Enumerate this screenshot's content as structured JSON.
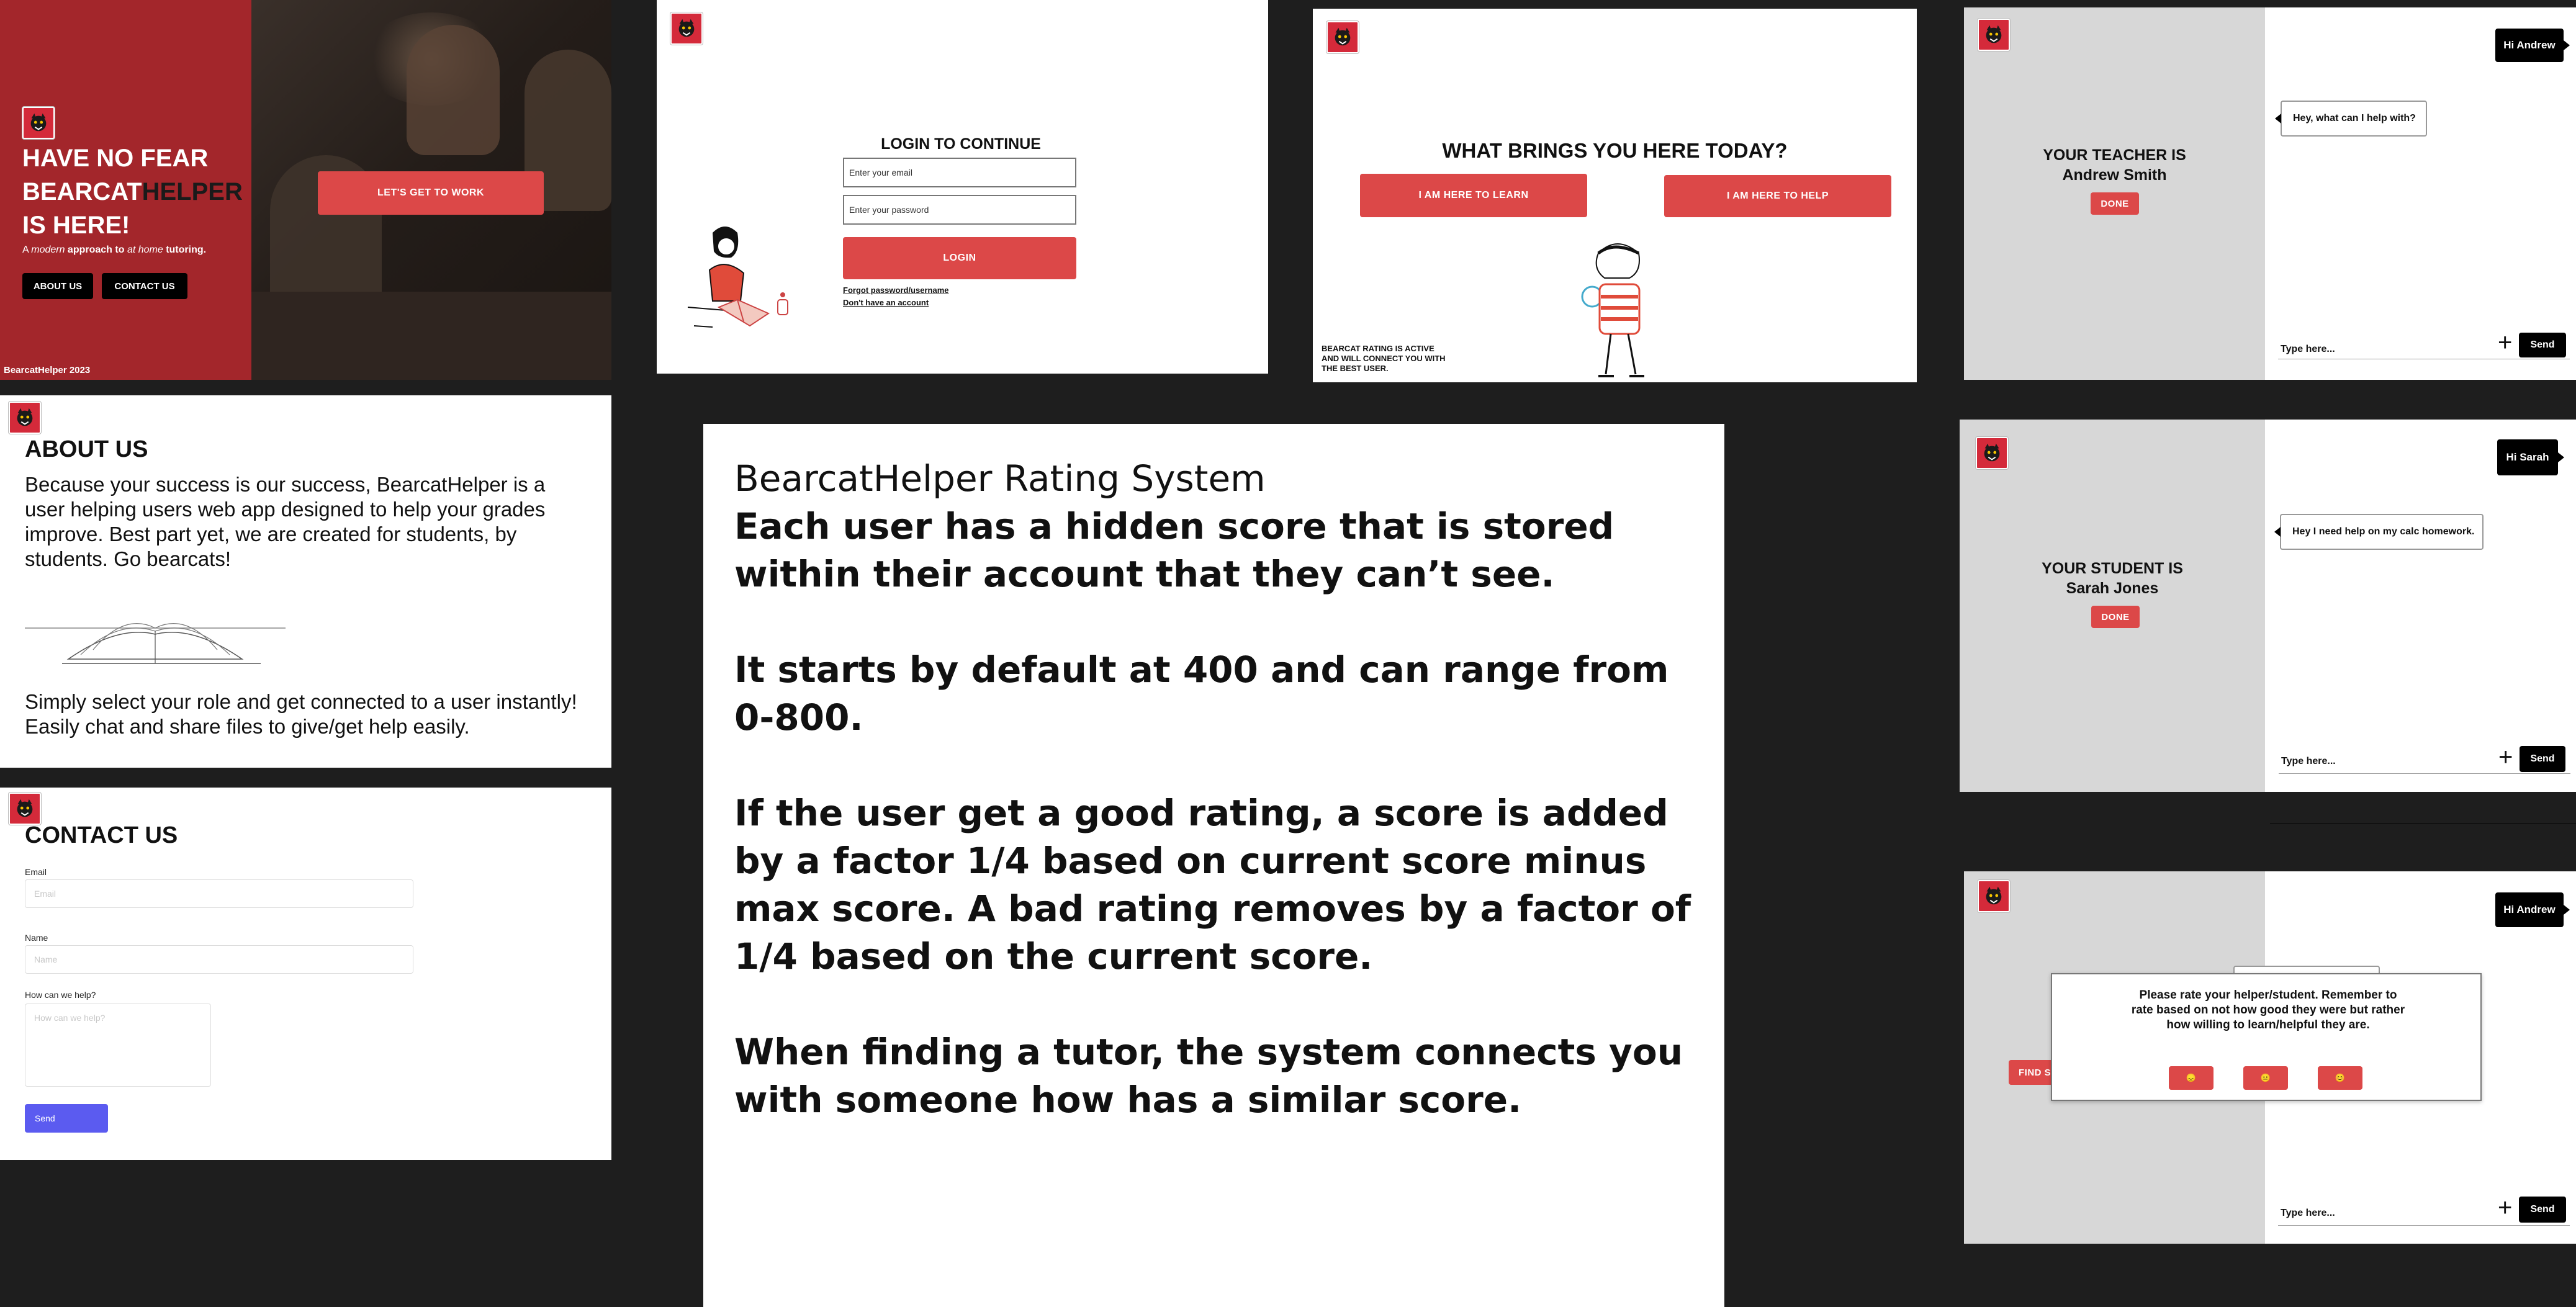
{
  "landing": {
    "headline_line1": "HAVE NO FEAR",
    "headline_brand_a": "BEARCAT",
    "headline_brand_b": "HELPER",
    "headline_line3": "IS HERE!",
    "tagline_a": "A ",
    "tagline_b": "modern",
    "tagline_c": " approach to ",
    "tagline_d": "at home",
    "tagline_e": " tutoring.",
    "about_button": "ABOUT US",
    "contact_button": "CONTACT US",
    "cta_button": "LET'S GET TO WORK",
    "footer": "BearcatHelper 2023"
  },
  "login": {
    "title": "LOGIN TO CONTINUE",
    "email_placeholder": "Enter your email",
    "password_placeholder": "Enter your password",
    "login_button": "LOGIN",
    "forgot_link": "Forgot password/username",
    "signup_link": "Don't have an account"
  },
  "role": {
    "title": "WHAT BRINGS YOU HERE TODAY?",
    "learn_button": "I AM HERE TO LEARN",
    "help_button": "I AM HERE TO HELP",
    "rating_note_1": "BEARCAT RATING IS ACTIVE",
    "rating_note_2": "AND WILL CONNECT YOU WITH",
    "rating_note_3": "THE BEST USER."
  },
  "chat_teacher": {
    "label_line1": "YOUR TEACHER IS",
    "label_line2": "Andrew Smith",
    "done_button": "DONE",
    "outgoing": "Hi Andrew",
    "incoming": "Hey, what can I help with?",
    "input_placeholder": "Type here...",
    "send_button": "Send"
  },
  "chat_student": {
    "label_line1": "YOUR STUDENT IS",
    "label_line2": "Sarah Jones",
    "done_button": "DONE",
    "outgoing": "Hi Sarah",
    "incoming": "Hey I need help on my calc homework.",
    "input_placeholder": "Type here...",
    "send_button": "Send"
  },
  "chat_rating": {
    "find_button": "FIND S",
    "outgoing": "Hi Andrew",
    "modal_text": "Please rate your helper/student. Remember to rate based on not how good they were but rather how willing to learn/helpful they are.",
    "rate_bad": "😞",
    "rate_ok": "😐",
    "rate_good": "😊",
    "input_placeholder": "Type here...",
    "send_button": "Send"
  },
  "about": {
    "title": "ABOUT US",
    "para1": "Because your success is our success, BearcatHelper is a user helping users web app designed to help your grades improve. Best part yet, we are created for students, by students. Go bearcats!",
    "para2": "Simply select your role and get connected to a user instantly! Easily chat and share files to give/get help easily."
  },
  "contact": {
    "title": "CONTACT US",
    "email_label": "Email",
    "email_placeholder": "Email",
    "name_label": "Name",
    "name_placeholder": "Name",
    "help_label": "How can we help?",
    "help_placeholder": "How can we help?",
    "send_button": "Send"
  },
  "rating_system": {
    "heading": "BearcatHelper Rating System",
    "p1": "Each user has a hidden score that is stored within their account that they can’t see.",
    "p2": "It starts by default at 400 and can range from 0-800.",
    "p3": "If the user get a good rating, a score is added by a factor 1/4 based on current score minus max score. A bad rating removes by a factor of 1/4 based on the current score.",
    "p4": "When finding a tutor, the system connects you with someone how has a similar score."
  },
  "colors": {
    "brand_red": "#dc4848",
    "dark_red": "#a3262b",
    "panel_grey": "#d7d7d7",
    "contact_send": "#5b5bf0",
    "canvas": "#1e1e1e"
  },
  "icons": [
    "bearcat-logo-icon",
    "plus-icon",
    "emoji-icon"
  ]
}
